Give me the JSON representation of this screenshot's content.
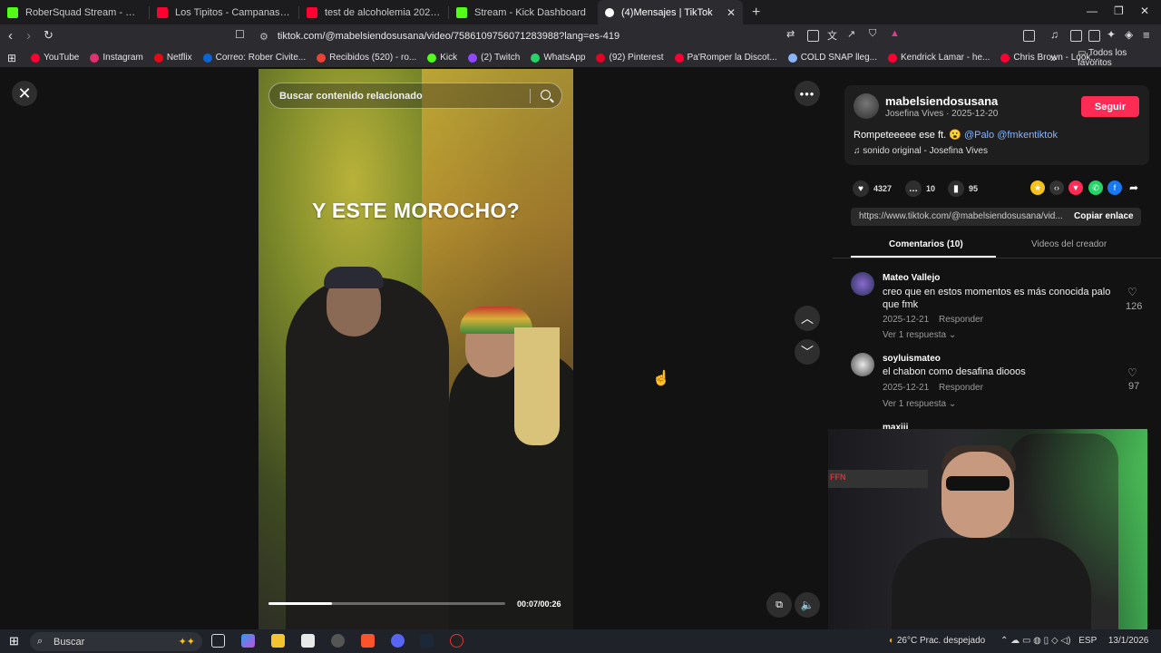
{
  "browser": {
    "tabs": [
      {
        "title": "RoberSquad Stream - Watch Live",
        "color": "#53fc18"
      },
      {
        "title": "Los Tipitos - Campanas en la noche",
        "color": "#ff0033"
      },
      {
        "title": "test de alcoholemia 2025 - YouTube",
        "color": "#ff0033"
      },
      {
        "title": "Stream - Kick Dashboard",
        "color": "#53fc18"
      },
      {
        "title": "(4)Mensajes | TikTok",
        "color": "#ffffff",
        "active": true
      }
    ],
    "url": "tiktok.com/@mabelsiendosusana/video/7586109756071283988?lang=es-419",
    "bookmarks": [
      {
        "label": "YouTube",
        "color": "#ff0033"
      },
      {
        "label": "Instagram",
        "color": "#e1306c"
      },
      {
        "label": "Netflix",
        "color": "#e50914"
      },
      {
        "label": "Correo: Rober Civite...",
        "color": "#0a64d4"
      },
      {
        "label": "Recibidos (520) - ro...",
        "color": "#ea4335"
      },
      {
        "label": "Kick",
        "color": "#53fc18"
      },
      {
        "label": "(2) Twitch",
        "color": "#9146ff"
      },
      {
        "label": "WhatsApp",
        "color": "#25d366"
      },
      {
        "label": "(92) Pinterest",
        "color": "#e60023"
      },
      {
        "label": "Pa'Romper la Discot...",
        "color": "#ff0033"
      },
      {
        "label": "COLD SNAP lleg...",
        "color": "#8ab4f8"
      },
      {
        "label": "Kendrick Lamar - he...",
        "color": "#ff0033"
      },
      {
        "label": "Chris Brown - Look...",
        "color": "#ff0033"
      }
    ],
    "all_bookmarks": "Todos los favoritos"
  },
  "video": {
    "search_placeholder": "Buscar contenido relacionado",
    "caption": "Y ESTE MOROCHO?",
    "time": "00:07/00:26",
    "progress": 0.27
  },
  "post": {
    "username": "mabelsiendosusana",
    "nick_date": "Josefina Vives · 2025-12-20",
    "follow": "Seguir",
    "desc_text": "Rompeteeeee ese ft. 😮",
    "mention1": "@Palo",
    "mention2": "@fmkentiktok",
    "music": "sonido original - Josefina Vives",
    "likes": "4327",
    "comments": "10",
    "saves": "95",
    "link": "https://www.tiktok.com/@mabelsiendosusana/vid...",
    "copy_link": "Copiar enlace",
    "tab_comments": "Comentarios (10)",
    "tab_creator": "Videos del creador"
  },
  "comments": [
    {
      "user": "Mateo Vallejo",
      "line1": "creo que en estos momentos es más conocida palo",
      "line2": "que fmk",
      "date": "2025-12-21",
      "reply": "Responder",
      "more": "Ver 1 respuesta",
      "likes": "126"
    },
    {
      "user": "soyluismateo",
      "line1": "el chabon como desafina diooos",
      "line2": "",
      "date": "2025-12-21",
      "reply": "Responder",
      "more": "Ver 1 respuesta",
      "likes": "97"
    },
    {
      "user": "maxiii"
    }
  ],
  "webcam_label": "FFN",
  "taskbar": {
    "search": "Buscar",
    "weather": "26°C  Prac. despejado",
    "lang": "ESP",
    "date": "13/1/2026"
  }
}
